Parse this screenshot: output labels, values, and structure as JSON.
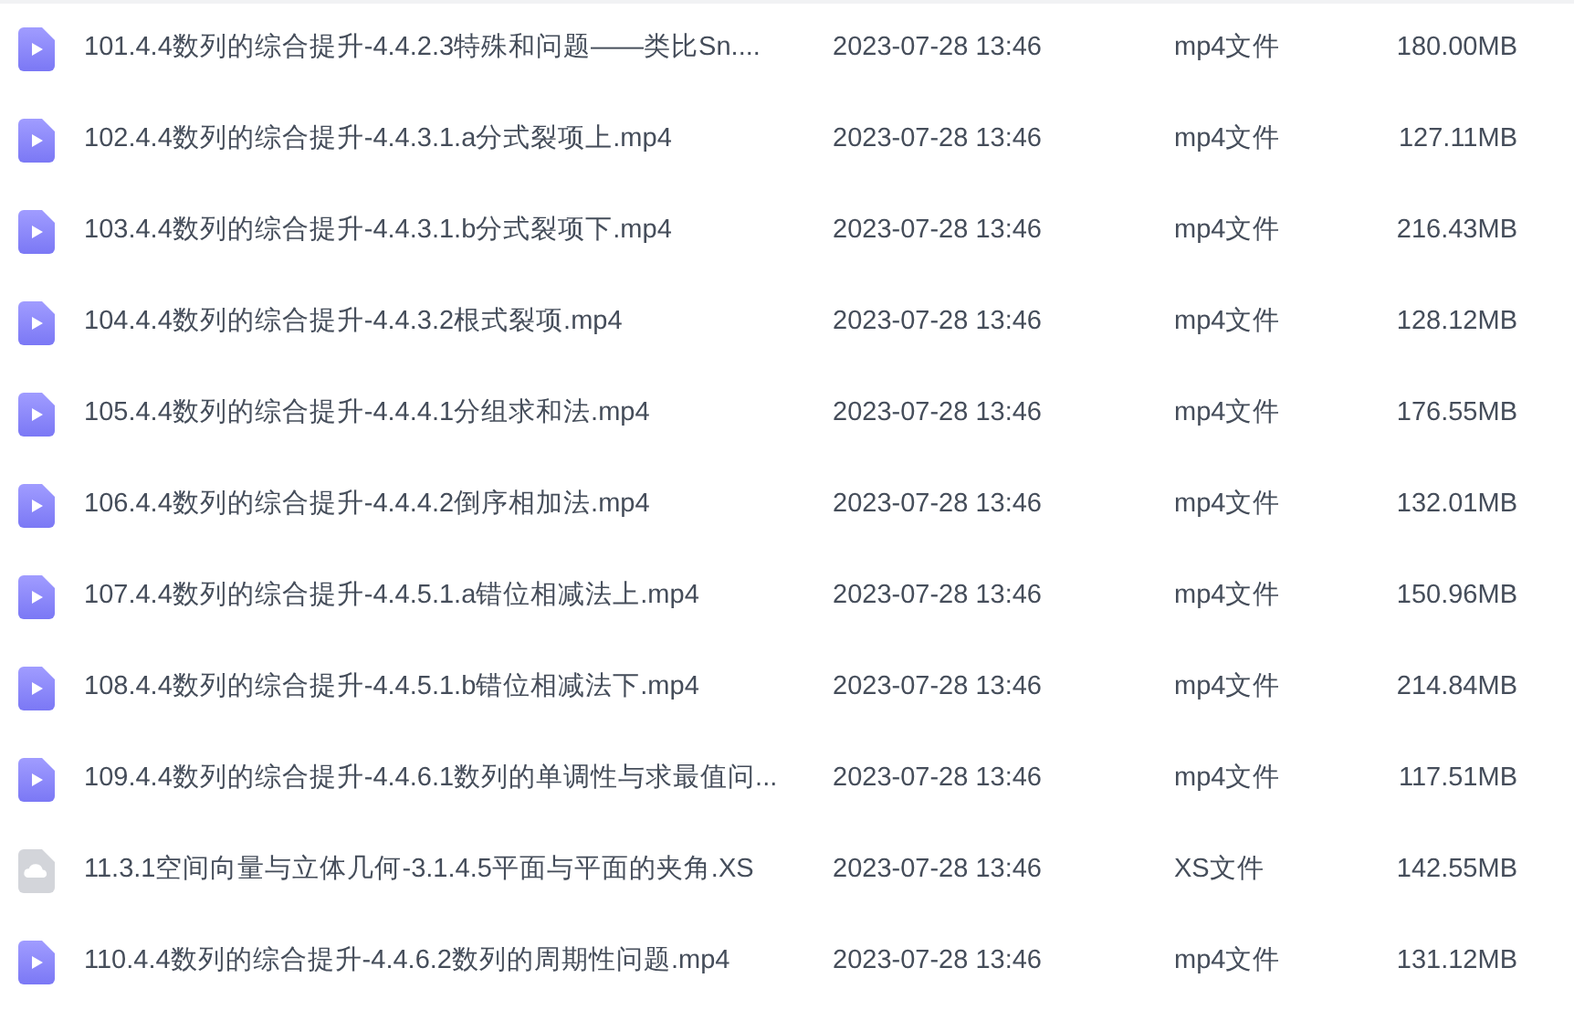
{
  "files": [
    {
      "kind": "video",
      "name": "101.4.4数列的综合提升-4.4.2.3特殊和问题——类比Sn....",
      "modified": "2023-07-28 13:46",
      "type": "mp4文件",
      "size": "180.00MB"
    },
    {
      "kind": "video",
      "name": "102.4.4数列的综合提升-4.4.3.1.a分式裂项上.mp4",
      "modified": "2023-07-28 13:46",
      "type": "mp4文件",
      "size": "127.11MB"
    },
    {
      "kind": "video",
      "name": "103.4.4数列的综合提升-4.4.3.1.b分式裂项下.mp4",
      "modified": "2023-07-28 13:46",
      "type": "mp4文件",
      "size": "216.43MB"
    },
    {
      "kind": "video",
      "name": "104.4.4数列的综合提升-4.4.3.2根式裂项.mp4",
      "modified": "2023-07-28 13:46",
      "type": "mp4文件",
      "size": "128.12MB"
    },
    {
      "kind": "video",
      "name": "105.4.4数列的综合提升-4.4.4.1分组求和法.mp4",
      "modified": "2023-07-28 13:46",
      "type": "mp4文件",
      "size": "176.55MB"
    },
    {
      "kind": "video",
      "name": "106.4.4数列的综合提升-4.4.4.2倒序相加法.mp4",
      "modified": "2023-07-28 13:46",
      "type": "mp4文件",
      "size": "132.01MB"
    },
    {
      "kind": "video",
      "name": "107.4.4数列的综合提升-4.4.5.1.a错位相减法上.mp4",
      "modified": "2023-07-28 13:46",
      "type": "mp4文件",
      "size": "150.96MB"
    },
    {
      "kind": "video",
      "name": "108.4.4数列的综合提升-4.4.5.1.b错位相减法下.mp4",
      "modified": "2023-07-28 13:46",
      "type": "mp4文件",
      "size": "214.84MB"
    },
    {
      "kind": "video",
      "name": "109.4.4数列的综合提升-4.4.6.1数列的单调性与求最值问...",
      "modified": "2023-07-28 13:46",
      "type": "mp4文件",
      "size": "117.51MB"
    },
    {
      "kind": "cloud",
      "name": "11.3.1空间向量与立体几何-3.1.4.5平面与平面的夹角.XS",
      "modified": "2023-07-28 13:46",
      "type": "XS文件",
      "size": "142.55MB"
    },
    {
      "kind": "video",
      "name": "110.4.4数列的综合提升-4.4.6.2数列的周期性问题.mp4",
      "modified": "2023-07-28 13:46",
      "type": "mp4文件",
      "size": "131.12MB"
    }
  ]
}
